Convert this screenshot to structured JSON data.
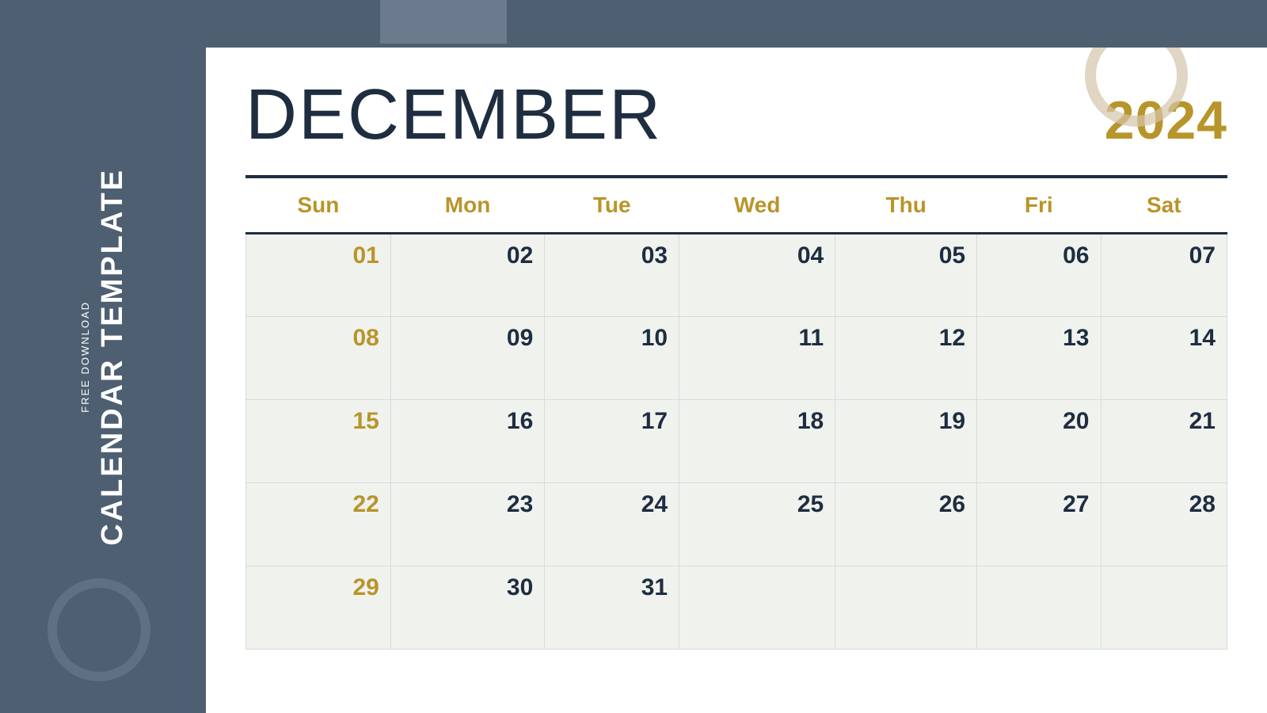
{
  "sidebar": {
    "free_download_label": "FREE DOWNLOAD",
    "calendar_template_label": "CALENDAR TEMPLATE"
  },
  "calendar": {
    "month": "DECEMBER",
    "year": "2024",
    "day_headers": [
      "Sun",
      "Mon",
      "Tue",
      "Wed",
      "Thu",
      "Fri",
      "Sat"
    ],
    "weeks": [
      [
        "01",
        "02",
        "03",
        "04",
        "05",
        "06",
        "07"
      ],
      [
        "08",
        "09",
        "10",
        "11",
        "12",
        "13",
        "14"
      ],
      [
        "15",
        "16",
        "17",
        "18",
        "19",
        "20",
        "21"
      ],
      [
        "22",
        "23",
        "24",
        "25",
        "26",
        "27",
        "28"
      ],
      [
        "29",
        "30",
        "31",
        "",
        "",
        "",
        ""
      ]
    ],
    "sunday_highlights": [
      "01",
      "08",
      "15",
      "22",
      "29"
    ]
  },
  "colors": {
    "background": "#4f5f72",
    "sidebar_text": "#ffffff",
    "calendar_bg": "#ffffff",
    "header_dark": "#1e2d40",
    "accent_gold": "#b8952a",
    "cell_bg": "#f0f2ee",
    "divider": "#1e2d40"
  }
}
